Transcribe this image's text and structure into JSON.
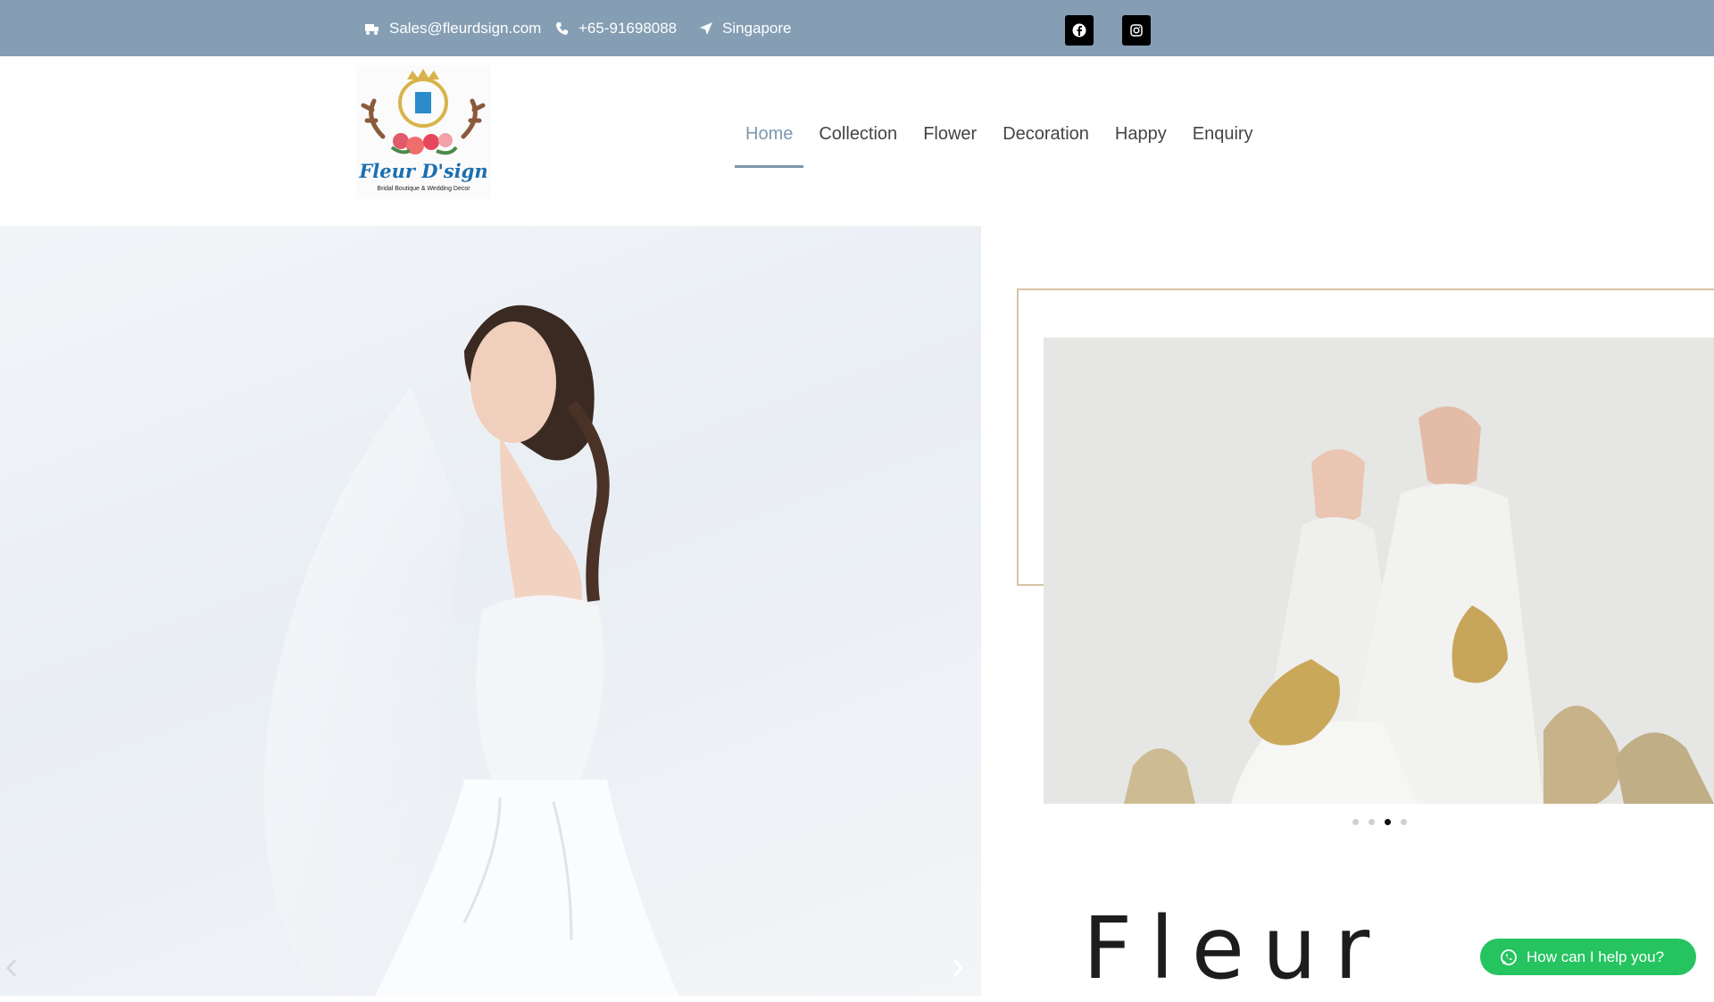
{
  "topbar": {
    "email": "Sales@fleurdsign.com",
    "phone": "+65-91698088",
    "location": "Singapore",
    "social": [
      "facebook-icon",
      "instagram-icon"
    ]
  },
  "logo": {
    "text": "Fleur D'sign",
    "subtitle": "Bridal Boutique & Wedding Decor"
  },
  "nav": {
    "items": [
      {
        "label": "Home",
        "active": true
      },
      {
        "label": "Collection"
      },
      {
        "label": "Flower"
      },
      {
        "label": "Decoration"
      },
      {
        "label": "Happy"
      },
      {
        "label": "Enquiry"
      }
    ]
  },
  "hero": {
    "prev_icon": "chevron-left-icon",
    "next_icon": "chevron-right-icon"
  },
  "slider": {
    "dot_count": 4,
    "active_dot": 3
  },
  "heading": "Fleur",
  "chat": {
    "label": "How can I help you?"
  },
  "colors": {
    "topbar": "#859eb4",
    "accent": "#7f97ad",
    "frame": "#d6c3a4",
    "chat": "#25c460"
  }
}
